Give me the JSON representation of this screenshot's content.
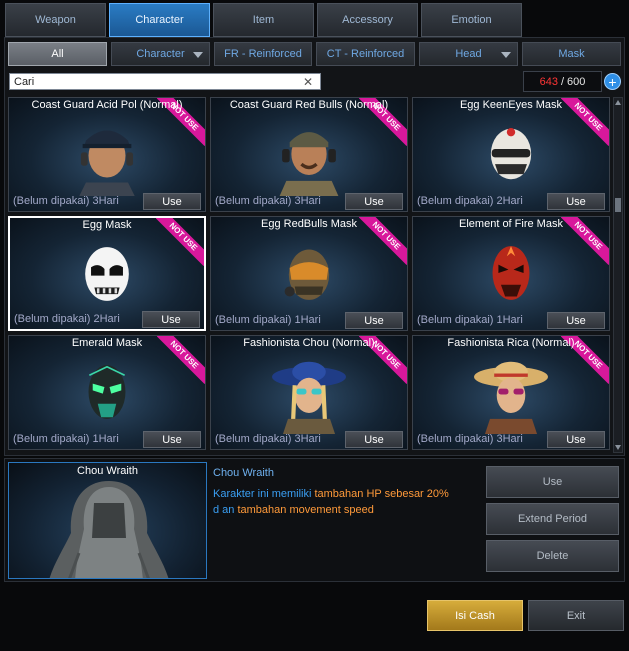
{
  "top_tabs": [
    {
      "label": "Weapon",
      "active": false
    },
    {
      "label": "Character",
      "active": true
    },
    {
      "label": "Item",
      "active": false
    },
    {
      "label": "Accessory",
      "active": false
    },
    {
      "label": "Emotion",
      "active": false
    }
  ],
  "sub_tabs": [
    {
      "label": "All",
      "active": true,
      "dropdown": false
    },
    {
      "label": "Character",
      "active": false,
      "dropdown": true
    },
    {
      "label": "FR - Reinforced",
      "active": false,
      "dropdown": false
    },
    {
      "label": "CT - Reinforced",
      "active": false,
      "dropdown": false
    },
    {
      "label": "Head",
      "active": false,
      "dropdown": true
    },
    {
      "label": "Mask",
      "active": false,
      "dropdown": false
    }
  ],
  "search": {
    "value": "Cari",
    "clear_icon": "close-icon"
  },
  "inventory": {
    "used": "643",
    "separator": "/",
    "max": "600",
    "add_icon": "plus-icon"
  },
  "items": [
    {
      "name": "Coast Guard Acid Pol (Normal)",
      "badge": "NOT USE",
      "status": "(Belum dipakai) 3Hari",
      "use_label": "Use",
      "portrait": "soldier-cap",
      "selected": false
    },
    {
      "name": "Coast Guard Red Bulls (Normal)",
      "badge": "NOT USE",
      "status": "(Belum dipakai) 3Hari",
      "use_label": "Use",
      "portrait": "soldier-headset",
      "selected": false
    },
    {
      "name": "Egg KeenEyes Mask",
      "badge": "NOT USE",
      "status": "(Belum dipakai) 2Hari",
      "use_label": "Use",
      "portrait": "egg-keeneyes",
      "selected": false
    },
    {
      "name": "Egg Mask",
      "badge": "NOT USE",
      "status": "(Belum dipakai) 2Hari",
      "use_label": "Use",
      "portrait": "egg-white",
      "selected": true
    },
    {
      "name": "Egg RedBulls Mask",
      "badge": "NOT USE",
      "status": "(Belum dipakai) 1Hari",
      "use_label": "Use",
      "portrait": "egg-redbulls",
      "selected": false
    },
    {
      "name": "Element of Fire Mask",
      "badge": "NOT USE",
      "status": "(Belum dipakai) 1Hari",
      "use_label": "Use",
      "portrait": "fire-mask",
      "selected": false
    },
    {
      "name": "Emerald Mask",
      "badge": "NOT USE",
      "status": "(Belum dipakai) 1Hari",
      "use_label": "Use",
      "portrait": "emerald-mask",
      "selected": false
    },
    {
      "name": "Fashionista Chou (Normal)",
      "badge": "NOT USE",
      "status": "(Belum dipakai) 3Hari",
      "use_label": "Use",
      "portrait": "fashion-blue-hat",
      "selected": false
    },
    {
      "name": "Fashionista Rica (Normal)",
      "badge": "NOT USE",
      "status": "(Belum dipakai) 3Hari",
      "use_label": "Use",
      "portrait": "fashion-straw-hat",
      "selected": false
    }
  ],
  "detail": {
    "preview_name": "Chou Wraith",
    "title": "Chou Wraith",
    "desc_parts": [
      {
        "text": "Karakter ini memiliki ",
        "highlight": false
      },
      {
        "text": "tambahan HP sebesar 20%",
        "highlight": true
      },
      {
        "text": " d an ",
        "highlight": false
      },
      {
        "text": "tambahan movement speed",
        "highlight": true
      }
    ],
    "buttons": [
      "Use",
      "Extend Period",
      "Delete"
    ]
  },
  "footer": {
    "isi_cash": "Isi Cash",
    "exit": "Exit"
  },
  "colors": {
    "accent": "#2a7cc4",
    "ribbon": "#d8189b",
    "counter_used": "#ff3535",
    "cash": "#d6ac3b"
  }
}
